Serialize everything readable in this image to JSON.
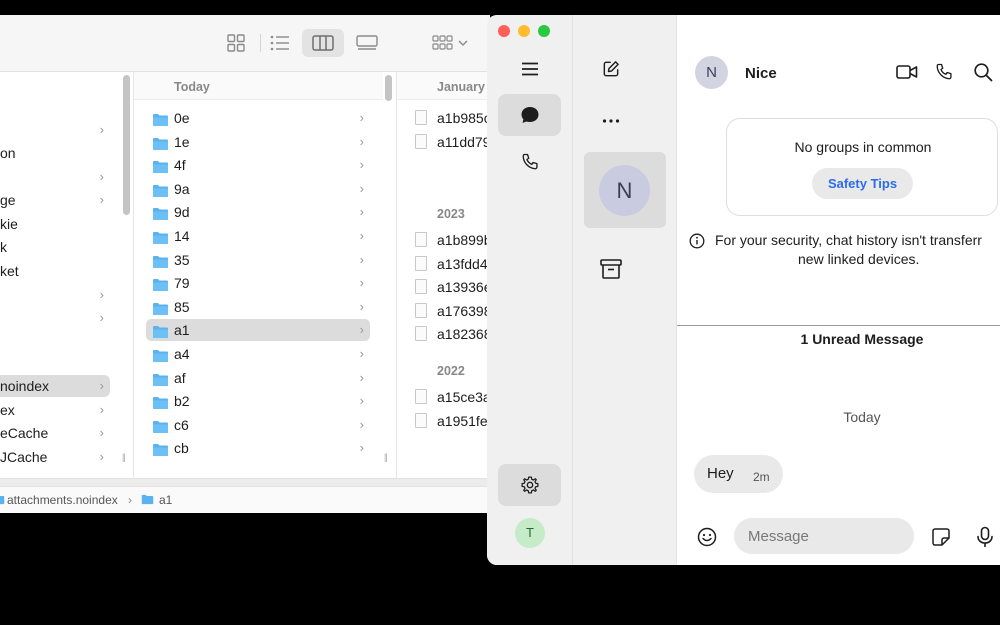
{
  "finder": {
    "sidebar_items": [
      {
        "label": "",
        "chevron": true
      },
      {
        "label": "on",
        "chevron": false
      },
      {
        "label": "",
        "chevron": true
      },
      {
        "label": "ge",
        "chevron": true
      },
      {
        "label": "kie",
        "chevron": false
      },
      {
        "label": "k",
        "chevron": false
      },
      {
        "label": "ket",
        "chevron": false
      },
      {
        "label": "",
        "chevron": true
      },
      {
        "label": "",
        "chevron": true
      },
      {
        "label": "",
        "chevron": false
      },
      {
        "label": "noindex",
        "chevron": true,
        "selected": true
      },
      {
        "label": "ex",
        "chevron": true
      },
      {
        "label": "eCache",
        "chevron": true
      },
      {
        "label": "JCache",
        "chevron": true
      }
    ],
    "folder_column": {
      "header": "Today",
      "items": [
        "0e",
        "1e",
        "4f",
        "9a",
        "9d",
        "14",
        "35",
        "79",
        "85",
        "a1",
        "a4",
        "af",
        "b2",
        "c6",
        "cb"
      ],
      "selected": "a1"
    },
    "file_column": {
      "header": "January",
      "groups": [
        {
          "header": "",
          "files": [
            "a1b985c",
            "a11dd79"
          ]
        },
        {
          "header": "2023",
          "files": [
            "a1b899b",
            "a13fdd4",
            "a13936e",
            "a176398",
            "a182368"
          ]
        },
        {
          "header": "2022",
          "files": [
            "a15ce3a",
            "a1951fe"
          ]
        }
      ]
    },
    "path": [
      "attachments.noindex",
      "a1"
    ],
    "path_separator": "›"
  },
  "signal": {
    "contact": {
      "name": "Nice",
      "initial": "N"
    },
    "user_initial": "T",
    "groups_card": {
      "text": "No groups in common",
      "button": "Safety Tips"
    },
    "security_note": {
      "line1": "For your security, chat history isn't transferr",
      "line2": "new linked devices."
    },
    "unread_label": "1 Unread Message",
    "day_label": "Today",
    "message": {
      "text": "Hey",
      "time": "2m"
    },
    "composer_placeholder": "Message",
    "colors": {
      "accent": "#2c6bed",
      "avatar_contact": "#c9cbe0",
      "avatar_user": "#c6ebc9",
      "traffic_red": "#ff5f57",
      "traffic_yellow": "#febc2e",
      "traffic_green": "#28c840"
    }
  }
}
